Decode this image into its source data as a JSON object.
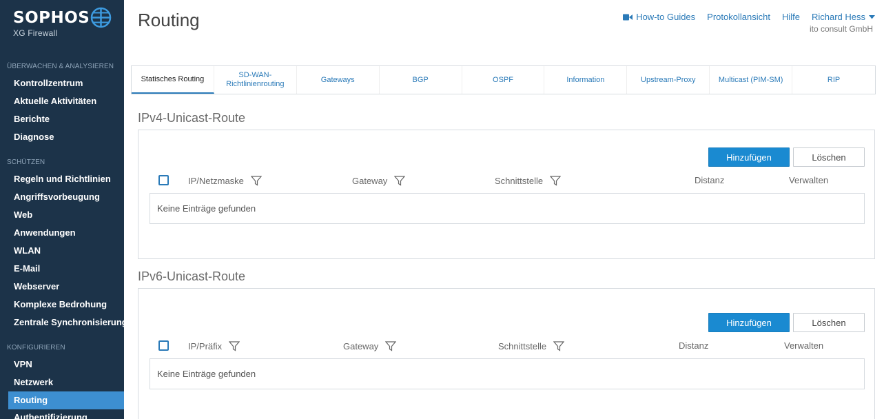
{
  "sidebar": {
    "brand": "SOPHOS",
    "product": "XG Firewall",
    "sections": [
      {
        "title": "ÜBERWACHEN & ANALYSIEREN",
        "items": [
          "Kontrollzentrum",
          "Aktuelle Aktivitäten",
          "Berichte",
          "Diagnose"
        ]
      },
      {
        "title": "SCHÜTZEN",
        "items": [
          "Regeln und Richtlinien",
          "Angriffsvorbeugung",
          "Web",
          "Anwendungen",
          "WLAN",
          "E-Mail",
          "Webserver",
          "Komplexe Bedrohung",
          "Zentrale Synchronisierung"
        ]
      },
      {
        "title": "KONFIGURIEREN",
        "items": [
          "VPN",
          "Netzwerk",
          "Routing",
          "Authentifizierung"
        ]
      }
    ],
    "active_item": "Routing"
  },
  "header": {
    "title": "Routing",
    "links": {
      "howto": "How-to Guides",
      "logs": "Protokollansicht",
      "help": "Hilfe",
      "user": "Richard Hess"
    },
    "company": "ito consult GmbH"
  },
  "tabs": [
    {
      "label": "Statisches Routing",
      "active": true
    },
    {
      "label": "SD-WAN-\nRichtlinienrouting",
      "active": false
    },
    {
      "label": "Gateways",
      "active": false
    },
    {
      "label": "BGP",
      "active": false
    },
    {
      "label": "OSPF",
      "active": false
    },
    {
      "label": "Information",
      "active": false
    },
    {
      "label": "Upstream-Proxy",
      "active": false
    },
    {
      "label": "Multicast (PIM-SM)",
      "active": false
    },
    {
      "label": "RIP",
      "active": false
    }
  ],
  "ipv4": {
    "title": "IPv4-Unicast-Route",
    "add": "Hinzufügen",
    "delete": "Löschen",
    "columns": [
      "IP/Netzmaske",
      "Gateway",
      "Schnittstelle",
      "Distanz",
      "Verwalten"
    ],
    "empty": "Keine Einträge gefunden"
  },
  "ipv6": {
    "title": "IPv6-Unicast-Route",
    "add": "Hinzufügen",
    "delete": "Löschen",
    "columns": [
      "IP/Präfix",
      "Gateway",
      "Schnittstelle",
      "Distanz",
      "Verwalten"
    ],
    "empty": "Keine Einträge gefunden"
  },
  "colors": {
    "sidebar_bg": "#1c3349",
    "accent": "#1a8ad1",
    "active_nav": "#3d8fd1",
    "link": "#2a7ab8"
  }
}
